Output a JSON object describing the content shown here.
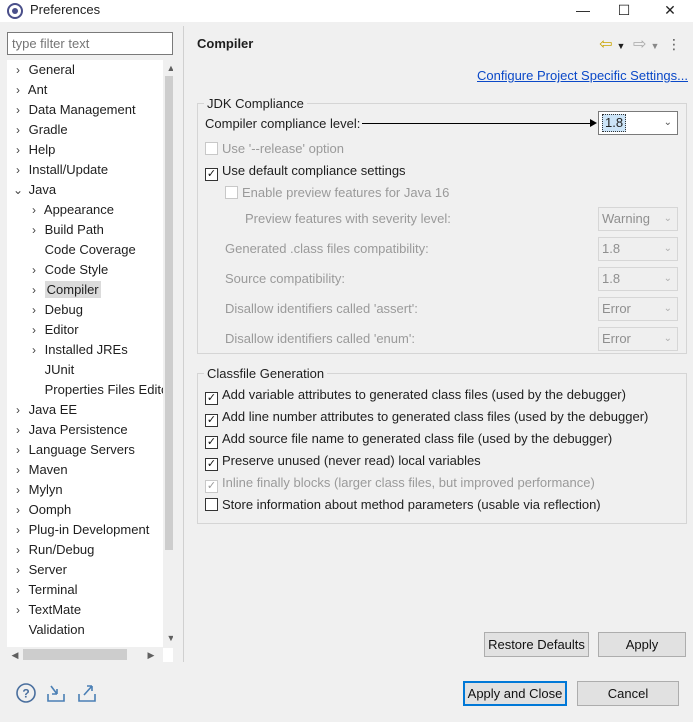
{
  "window": {
    "title": "Preferences"
  },
  "filter": {
    "placeholder": "type filter text"
  },
  "tree": [
    {
      "label": "General",
      "level": 0,
      "chevron": "›"
    },
    {
      "label": "Ant",
      "level": 0,
      "chevron": "›"
    },
    {
      "label": "Data Management",
      "level": 0,
      "chevron": "›"
    },
    {
      "label": "Gradle",
      "level": 0,
      "chevron": "›"
    },
    {
      "label": "Help",
      "level": 0,
      "chevron": "›"
    },
    {
      "label": "Install/Update",
      "level": 0,
      "chevron": "›"
    },
    {
      "label": "Java",
      "level": 0,
      "chevron": "⌄"
    },
    {
      "label": "Appearance",
      "level": 1,
      "chevron": "›"
    },
    {
      "label": "Build Path",
      "level": 1,
      "chevron": "›"
    },
    {
      "label": "Code Coverage",
      "level": 1,
      "chevron": ""
    },
    {
      "label": "Code Style",
      "level": 1,
      "chevron": "›"
    },
    {
      "label": "Compiler",
      "level": 1,
      "chevron": "›",
      "selected": true
    },
    {
      "label": "Debug",
      "level": 1,
      "chevron": "›"
    },
    {
      "label": "Editor",
      "level": 1,
      "chevron": "›"
    },
    {
      "label": "Installed JREs",
      "level": 1,
      "chevron": "›"
    },
    {
      "label": "JUnit",
      "level": 1,
      "chevron": ""
    },
    {
      "label": "Properties Files Editor",
      "level": 1,
      "chevron": ""
    },
    {
      "label": "Java EE",
      "level": 0,
      "chevron": "›"
    },
    {
      "label": "Java Persistence",
      "level": 0,
      "chevron": "›"
    },
    {
      "label": "Language Servers",
      "level": 0,
      "chevron": "›"
    },
    {
      "label": "Maven",
      "level": 0,
      "chevron": "›"
    },
    {
      "label": "Mylyn",
      "level": 0,
      "chevron": "›"
    },
    {
      "label": "Oomph",
      "level": 0,
      "chevron": "›"
    },
    {
      "label": "Plug-in Development",
      "level": 0,
      "chevron": "›"
    },
    {
      "label": "Run/Debug",
      "level": 0,
      "chevron": "›"
    },
    {
      "label": "Server",
      "level": 0,
      "chevron": "›"
    },
    {
      "label": "Terminal",
      "level": 0,
      "chevron": "›"
    },
    {
      "label": "TextMate",
      "level": 0,
      "chevron": "›"
    },
    {
      "label": "Validation",
      "level": 0,
      "chevron": ""
    }
  ],
  "page": {
    "title": "Compiler",
    "config_link": "Configure Project Specific Settings...",
    "jdk": {
      "legend": "JDK Compliance",
      "compliance_label": "Compiler compliance level:",
      "compliance_value": "1.8",
      "release_label": "Use '--release' option",
      "default_label": "Use default compliance settings",
      "preview_label": "Enable preview features for Java 16",
      "severity_label": "Preview features with severity level:",
      "severity_value": "Warning",
      "generated_label": "Generated .class files compatibility:",
      "generated_value": "1.8",
      "source_label": "Source compatibility:",
      "source_value": "1.8",
      "assert_label": "Disallow identifiers called 'assert':",
      "assert_value": "Error",
      "enum_label": "Disallow identifiers called 'enum':",
      "enum_value": "Error"
    },
    "classfile": {
      "legend": "Classfile Generation",
      "items": [
        "Add variable attributes to generated class files (used by the debugger)",
        "Add line number attributes to generated class files (used by the debugger)",
        "Add source file name to generated class file (used by the debugger)",
        "Preserve unused (never read) local variables",
        "Inline finally blocks (larger class files, but improved performance)",
        "Store information about method parameters (usable via reflection)"
      ]
    },
    "restore_label": "Restore Defaults",
    "apply_label": "Apply"
  },
  "footer": {
    "apply_close_label": "Apply and Close",
    "cancel_label": "Cancel"
  }
}
